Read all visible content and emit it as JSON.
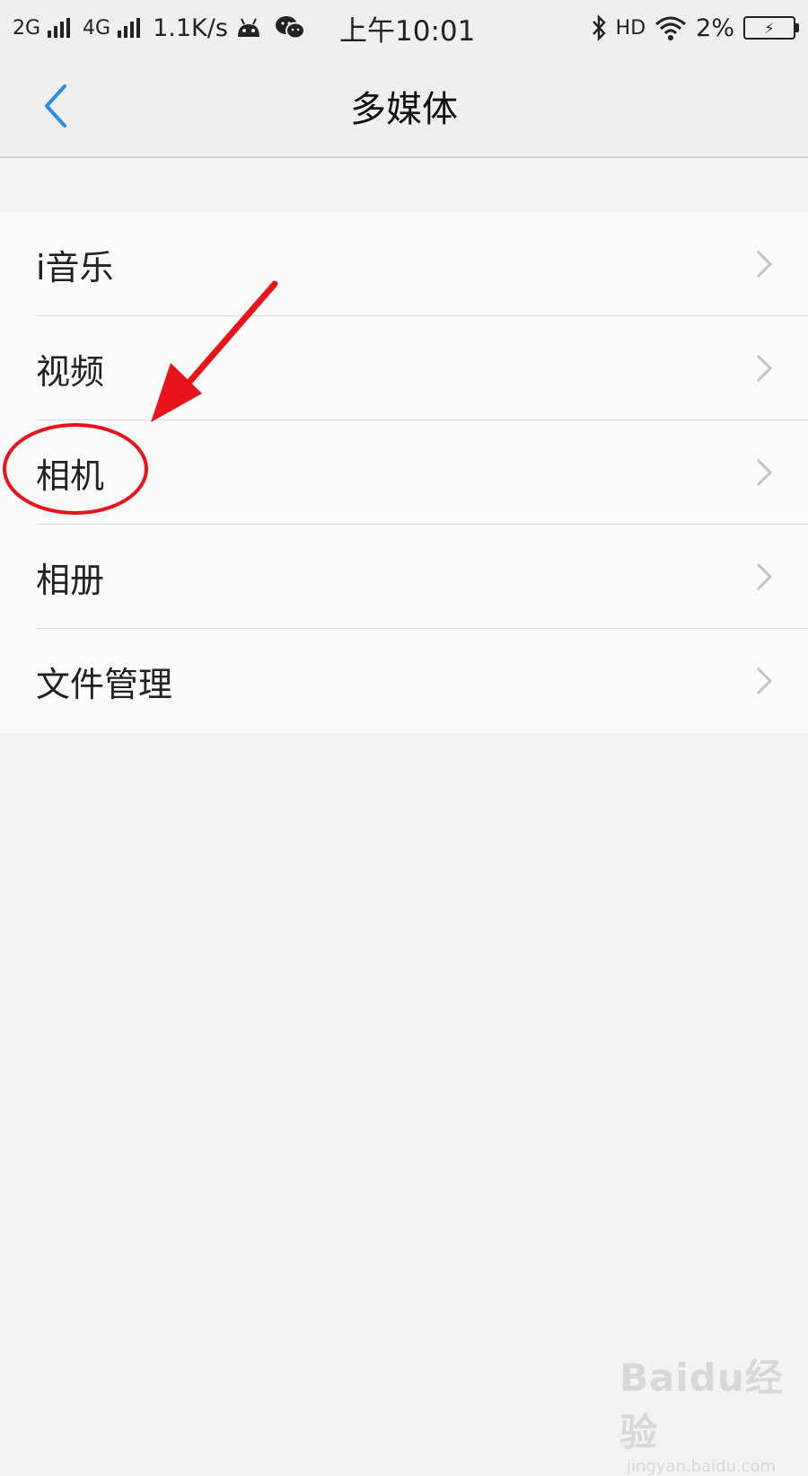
{
  "status_bar": {
    "net1": "2G",
    "net2": "4G",
    "speed": "1.1K/s",
    "time": "上午10:01",
    "hd": "HD",
    "battery": "2%"
  },
  "header": {
    "title": "多媒体"
  },
  "menu": {
    "items": [
      {
        "label": "i音乐"
      },
      {
        "label": "视频"
      },
      {
        "label": "相机"
      },
      {
        "label": "相册"
      },
      {
        "label": "文件管理"
      }
    ]
  },
  "annotation": {
    "color": "#e8131b",
    "highlighted_item": "相机"
  },
  "watermark": {
    "brand": "Baidu经验",
    "url": "jingyan.baidu.com"
  },
  "colors": {
    "accent": "#2a8ee8",
    "background": "#f3f3f3",
    "list_background": "#fafafa"
  }
}
